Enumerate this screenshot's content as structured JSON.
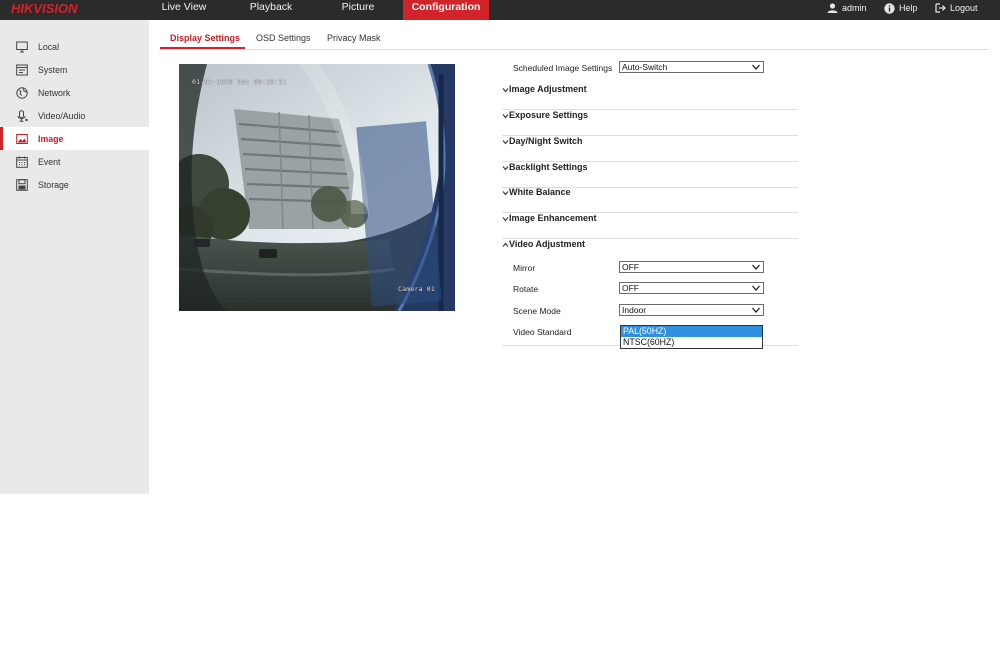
{
  "brand": {
    "logo": "HIKVISION",
    "accent": "#d2232a",
    "topbar_bg": "#2b2b2b"
  },
  "nav": {
    "items": [
      {
        "label": "Live View",
        "active": false
      },
      {
        "label": "Playback",
        "active": false
      },
      {
        "label": "Picture",
        "active": false
      },
      {
        "label": "Configuration",
        "active": true
      }
    ]
  },
  "user_menu": {
    "user": {
      "icon": "user-icon",
      "label": "admin"
    },
    "help": {
      "icon": "help-icon",
      "label": "Help"
    },
    "logout": {
      "icon": "logout-icon",
      "label": "Logout"
    }
  },
  "sidebar": {
    "items": [
      {
        "icon": "monitor-icon",
        "label": "Local",
        "active": false
      },
      {
        "icon": "system-icon",
        "label": "System",
        "active": false
      },
      {
        "icon": "globe-icon",
        "label": "Network",
        "active": false
      },
      {
        "icon": "mic-icon",
        "label": "Video/Audio",
        "active": false
      },
      {
        "icon": "image-icon",
        "label": "Image",
        "active": true
      },
      {
        "icon": "calendar-icon",
        "label": "Event",
        "active": false
      },
      {
        "icon": "storage-icon",
        "label": "Storage",
        "active": false
      }
    ]
  },
  "subtabs": {
    "items": [
      {
        "label": "Display Settings",
        "active": true
      },
      {
        "label": "OSD Settings",
        "active": false
      },
      {
        "label": "Privacy Mask",
        "active": false
      }
    ]
  },
  "preview": {
    "timestamp": "01-01-2020 Sat 00:29:31",
    "camera_name": "Camera 01"
  },
  "settings": {
    "scheduled": {
      "label": "Scheduled Image Settings",
      "value": "Auto-Switch"
    },
    "sections": [
      {
        "title": "Image Adjustment",
        "expanded": false
      },
      {
        "title": "Exposure Settings",
        "expanded": false
      },
      {
        "title": "Day/Night Switch",
        "expanded": false
      },
      {
        "title": "Backlight Settings",
        "expanded": false
      },
      {
        "title": "White Balance",
        "expanded": false
      },
      {
        "title": "Image Enhancement",
        "expanded": false
      },
      {
        "title": "Video Adjustment",
        "expanded": true
      }
    ],
    "video_adjustment": {
      "mirror": {
        "label": "Mirror",
        "value": "OFF"
      },
      "rotate": {
        "label": "Rotate",
        "value": "OFF"
      },
      "scene_mode": {
        "label": "Scene Mode",
        "value": "Indoor"
      },
      "video_standard": {
        "label": "Video Standard",
        "options": [
          "PAL(50HZ)",
          "NTSC(60HZ)"
        ],
        "selected": "PAL(50HZ)"
      }
    }
  }
}
